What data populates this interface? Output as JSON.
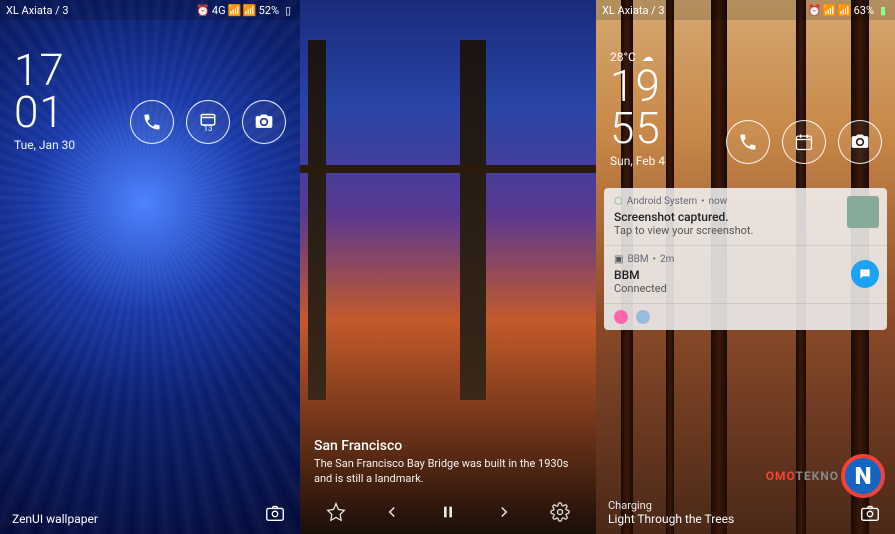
{
  "screen1": {
    "status": {
      "carrier": "XL Axiata / 3",
      "network": "4G",
      "battery": "52%"
    },
    "clock": {
      "hour": "17",
      "minute": "01",
      "date": "Tue, Jan 30"
    },
    "shortcuts": {
      "phone": "phone-icon",
      "calendar": "calendar-icon",
      "calendar_day": "13",
      "camera": "camera-icon"
    },
    "bottom": {
      "label": "ZenUI wallpaper"
    }
  },
  "screen2": {
    "caption": {
      "title": "San Francisco",
      "desc": "The San Francisco Bay Bridge was built in the 1930s and is still a landmark."
    },
    "controls": {
      "fav": "star-icon",
      "prev": "prev-icon",
      "pause": "pause-icon",
      "next": "next-icon",
      "settings": "gear-icon"
    }
  },
  "screen3": {
    "status": {
      "carrier": "XL Axiata / 3",
      "battery": "63%"
    },
    "weather": {
      "temp": "28°C",
      "icon": "cloud-icon"
    },
    "clock": {
      "hour": "19",
      "minute": "55",
      "date": "Sun, Feb 4"
    },
    "notifs": [
      {
        "app": "Android System",
        "time": "now",
        "title": "Screenshot captured.",
        "body": "Tap to view your screenshot."
      },
      {
        "app": "BBM",
        "time": "2m",
        "title": "BBM",
        "body": "Connected"
      }
    ],
    "charging": {
      "label": "Charging",
      "wallpaper": "Light Through the Trees"
    },
    "logo": {
      "text_left": "OMO",
      "text_right": "TEKNO",
      "letter": "N"
    }
  }
}
